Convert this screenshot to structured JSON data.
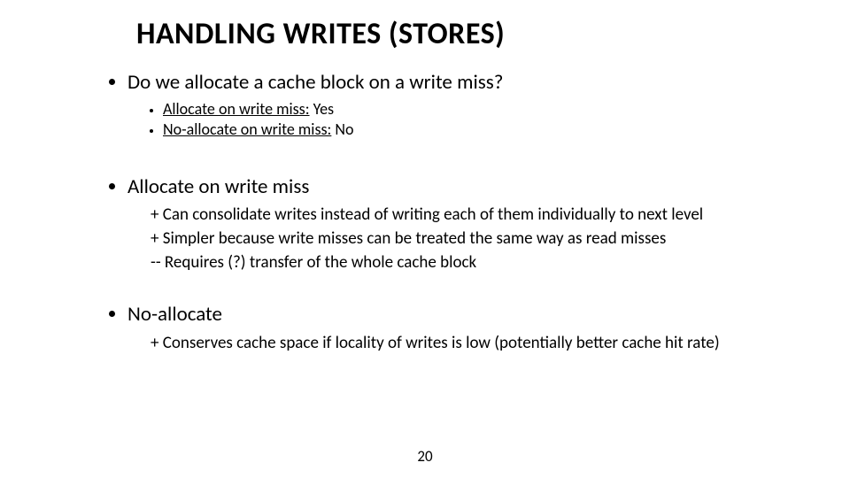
{
  "title": "HANDLING WRITES (STORES)",
  "section1": {
    "heading": "Do we allocate a cache block on a write miss?",
    "items": [
      {
        "label": "Allocate on write miss:",
        "answer": "Yes"
      },
      {
        "label": "No-allocate on write miss:",
        "answer": "No"
      }
    ]
  },
  "section2": {
    "heading": "Allocate on write miss",
    "points": [
      "+ Can consolidate writes instead of writing each of them individually to next level",
      "+ Simpler because write misses can be treated the same way as read misses",
      "-- Requires (?) transfer of the whole cache block"
    ]
  },
  "section3": {
    "heading": "No-allocate",
    "points": [
      "+ Conserves cache space if locality of writes is low (potentially better cache hit rate)"
    ]
  },
  "page_number": "20"
}
